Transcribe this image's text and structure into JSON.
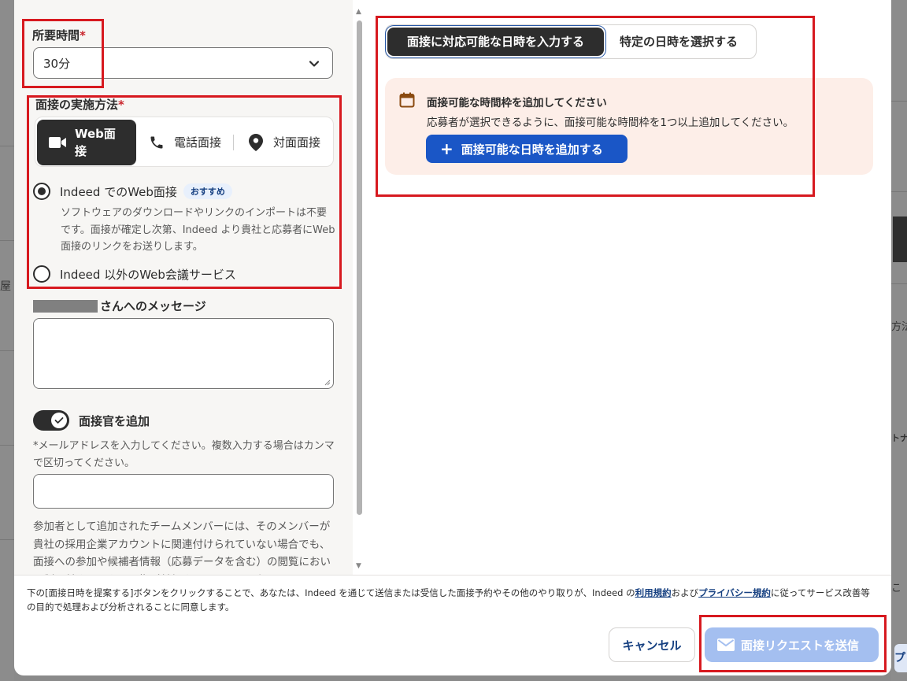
{
  "background": {
    "left_fragment": "屋",
    "right_fragments": [
      "方法",
      "トナ",
      "こ",
      "プ"
    ]
  },
  "duration": {
    "label": "所要時間",
    "required_mark": "*",
    "selected": "30分"
  },
  "method": {
    "label": "面接の実施方法",
    "required_mark": "*",
    "options": [
      {
        "label": "Web面接",
        "icon": "video-camera-icon"
      },
      {
        "label": "電話面接",
        "icon": "phone-icon"
      },
      {
        "label": "対面面接",
        "icon": "location-pin-icon"
      }
    ],
    "selected": "Web面接"
  },
  "web_options": {
    "indeed_label": "Indeed でのWeb面接",
    "indeed_badge": "おすすめ",
    "indeed_desc": "ソフトウェアのダウンロードやリンクのインポートは不要です。面接が確定し次第、Indeed より貴社と応募者にWeb面接のリンクをお送りします。",
    "other_label": "Indeed 以外のWeb会議サービス"
  },
  "message": {
    "label_suffix": "さんへのメッセージ",
    "value": ""
  },
  "interviewer": {
    "toggle_label": "面接官を追加",
    "toggle_on": true,
    "email_hint": "*メールアドレスを入力してください。複数入力する場合はカンマで区切ってください。",
    "email_value": "",
    "member_note": "参加者として追加されたチームメンバーには、そのメンバーが貴社の採用企業アカウントに関連付けられていない場合でも、面接への参加や候補者情報（応募データを含む）の閲覧において制限付きのアクセス権が付与されます。アカウント"
  },
  "schedule_tabs": {
    "active": "面接に対応可能な日時を入力する",
    "inactive": "特定の日時を選択する"
  },
  "availability_alert": {
    "icon": "calendar-icon",
    "title": "面接可能な時間枠を追加してください",
    "description": "応募者が選択できるように、面接可能な時間枠を1つ以上追加してください。",
    "button": "面接可能な日時を追加する"
  },
  "footer": {
    "consent_pre": "下の[面接日時を提案する]ボタンをクリックすることで、あなたは、Indeed を通じて送信または受信した面接予約やその他のやり取りが、Indeed の",
    "terms_link": "利用規約",
    "consent_mid": "および",
    "privacy_link": "プライバシー規約",
    "consent_post": "に従ってサービス改善等の目的で処理および分析されることに同意します。",
    "cancel": "キャンセル",
    "send": "面接リクエストを送信"
  },
  "colors": {
    "primary_blue": "#1a56c6",
    "dark": "#2d2d2d",
    "alert_bg": "#fdeee8",
    "annotation_red": "#d7191f",
    "send_disabled": "#a4bff0"
  }
}
